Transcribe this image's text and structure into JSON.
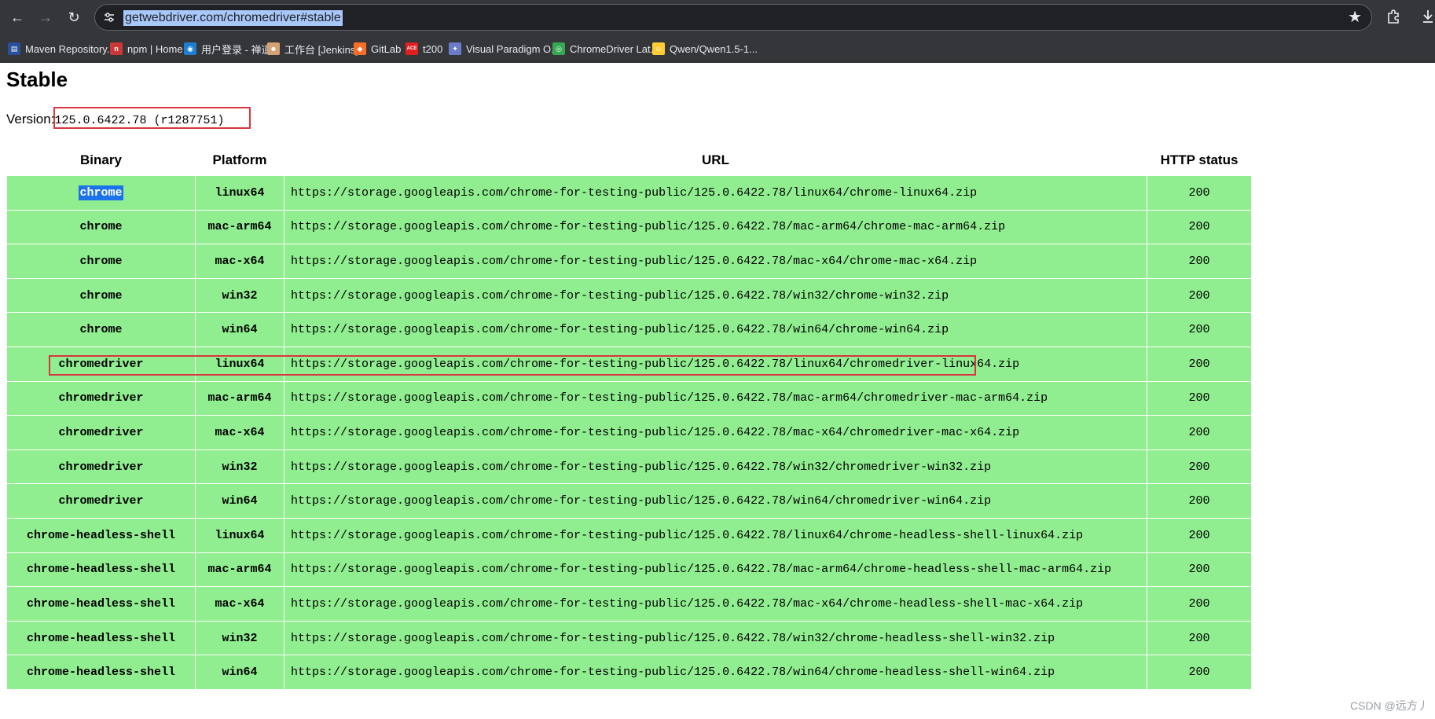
{
  "browser": {
    "url": "getwebdriver.com/chromedriver#stable",
    "bookmarks": [
      {
        "label": "Maven Repository...",
        "icon": "maven-icon",
        "color": "#2b4f9c",
        "glyph": "▤"
      },
      {
        "label": "npm | Home",
        "icon": "npm-icon",
        "color": "#cb3837",
        "glyph": "n"
      },
      {
        "label": "用户登录 - 禅道",
        "icon": "zentao-icon",
        "color": "#1f7ed0",
        "glyph": "◉"
      },
      {
        "label": "工作台 [Jenkins]",
        "icon": "jenkins-icon",
        "color": "#d4a373",
        "glyph": "☻"
      },
      {
        "label": "GitLab",
        "icon": "gitlab-icon",
        "color": "#fc6d26",
        "glyph": "◆"
      },
      {
        "label": "t200",
        "icon": "t200-icon",
        "color": "#e02020",
        "glyph": "ACE"
      },
      {
        "label": "Visual Paradigm O...",
        "icon": "visual-paradigm-icon",
        "color": "#6b7cc8",
        "glyph": "✦"
      },
      {
        "label": "ChromeDriver Lat...",
        "icon": "chrome-icon",
        "color": "#34a853",
        "glyph": "◎"
      },
      {
        "label": "Qwen/Qwen1.5-1...",
        "icon": "huggingface-icon",
        "color": "#ffcc33",
        "glyph": "☺"
      }
    ]
  },
  "page": {
    "title": "Stable",
    "version_label": "Version:",
    "version_value": "125.0.6422.78 (r1287751)"
  },
  "table": {
    "headers": [
      "Binary",
      "Platform",
      "URL",
      "HTTP status"
    ],
    "rows": [
      {
        "binary": "chrome",
        "platform": "linux64",
        "url": "https://storage.googleapis.com/chrome-for-testing-public/125.0.6422.78/linux64/chrome-linux64.zip",
        "status": "200"
      },
      {
        "binary": "chrome",
        "platform": "mac-arm64",
        "url": "https://storage.googleapis.com/chrome-for-testing-public/125.0.6422.78/mac-arm64/chrome-mac-arm64.zip",
        "status": "200"
      },
      {
        "binary": "chrome",
        "platform": "mac-x64",
        "url": "https://storage.googleapis.com/chrome-for-testing-public/125.0.6422.78/mac-x64/chrome-mac-x64.zip",
        "status": "200"
      },
      {
        "binary": "chrome",
        "platform": "win32",
        "url": "https://storage.googleapis.com/chrome-for-testing-public/125.0.6422.78/win32/chrome-win32.zip",
        "status": "200"
      },
      {
        "binary": "chrome",
        "platform": "win64",
        "url": "https://storage.googleapis.com/chrome-for-testing-public/125.0.6422.78/win64/chrome-win64.zip",
        "status": "200"
      },
      {
        "binary": "chromedriver",
        "platform": "linux64",
        "url": "https://storage.googleapis.com/chrome-for-testing-public/125.0.6422.78/linux64/chromedriver-linux64.zip",
        "status": "200"
      },
      {
        "binary": "chromedriver",
        "platform": "mac-arm64",
        "url": "https://storage.googleapis.com/chrome-for-testing-public/125.0.6422.78/mac-arm64/chromedriver-mac-arm64.zip",
        "status": "200"
      },
      {
        "binary": "chromedriver",
        "platform": "mac-x64",
        "url": "https://storage.googleapis.com/chrome-for-testing-public/125.0.6422.78/mac-x64/chromedriver-mac-x64.zip",
        "status": "200"
      },
      {
        "binary": "chromedriver",
        "platform": "win32",
        "url": "https://storage.googleapis.com/chrome-for-testing-public/125.0.6422.78/win32/chromedriver-win32.zip",
        "status": "200"
      },
      {
        "binary": "chromedriver",
        "platform": "win64",
        "url": "https://storage.googleapis.com/chrome-for-testing-public/125.0.6422.78/win64/chromedriver-win64.zip",
        "status": "200"
      },
      {
        "binary": "chrome-headless-shell",
        "platform": "linux64",
        "url": "https://storage.googleapis.com/chrome-for-testing-public/125.0.6422.78/linux64/chrome-headless-shell-linux64.zip",
        "status": "200"
      },
      {
        "binary": "chrome-headless-shell",
        "platform": "mac-arm64",
        "url": "https://storage.googleapis.com/chrome-for-testing-public/125.0.6422.78/mac-arm64/chrome-headless-shell-mac-arm64.zip",
        "status": "200"
      },
      {
        "binary": "chrome-headless-shell",
        "platform": "mac-x64",
        "url": "https://storage.googleapis.com/chrome-for-testing-public/125.0.6422.78/mac-x64/chrome-headless-shell-mac-x64.zip",
        "status": "200"
      },
      {
        "binary": "chrome-headless-shell",
        "platform": "win32",
        "url": "https://storage.googleapis.com/chrome-for-testing-public/125.0.6422.78/win32/chrome-headless-shell-win32.zip",
        "status": "200"
      },
      {
        "binary": "chrome-headless-shell",
        "platform": "win64",
        "url": "https://storage.googleapis.com/chrome-for-testing-public/125.0.6422.78/win64/chrome-headless-shell-win64.zip",
        "status": "200"
      }
    ],
    "selected_row": 0,
    "highlighted_row": 5
  },
  "colors": {
    "row_background": "#90ee90",
    "annotation_border": "#d9363e",
    "selection": "#1a73e8"
  },
  "watermark": "CSDN @远方丿"
}
